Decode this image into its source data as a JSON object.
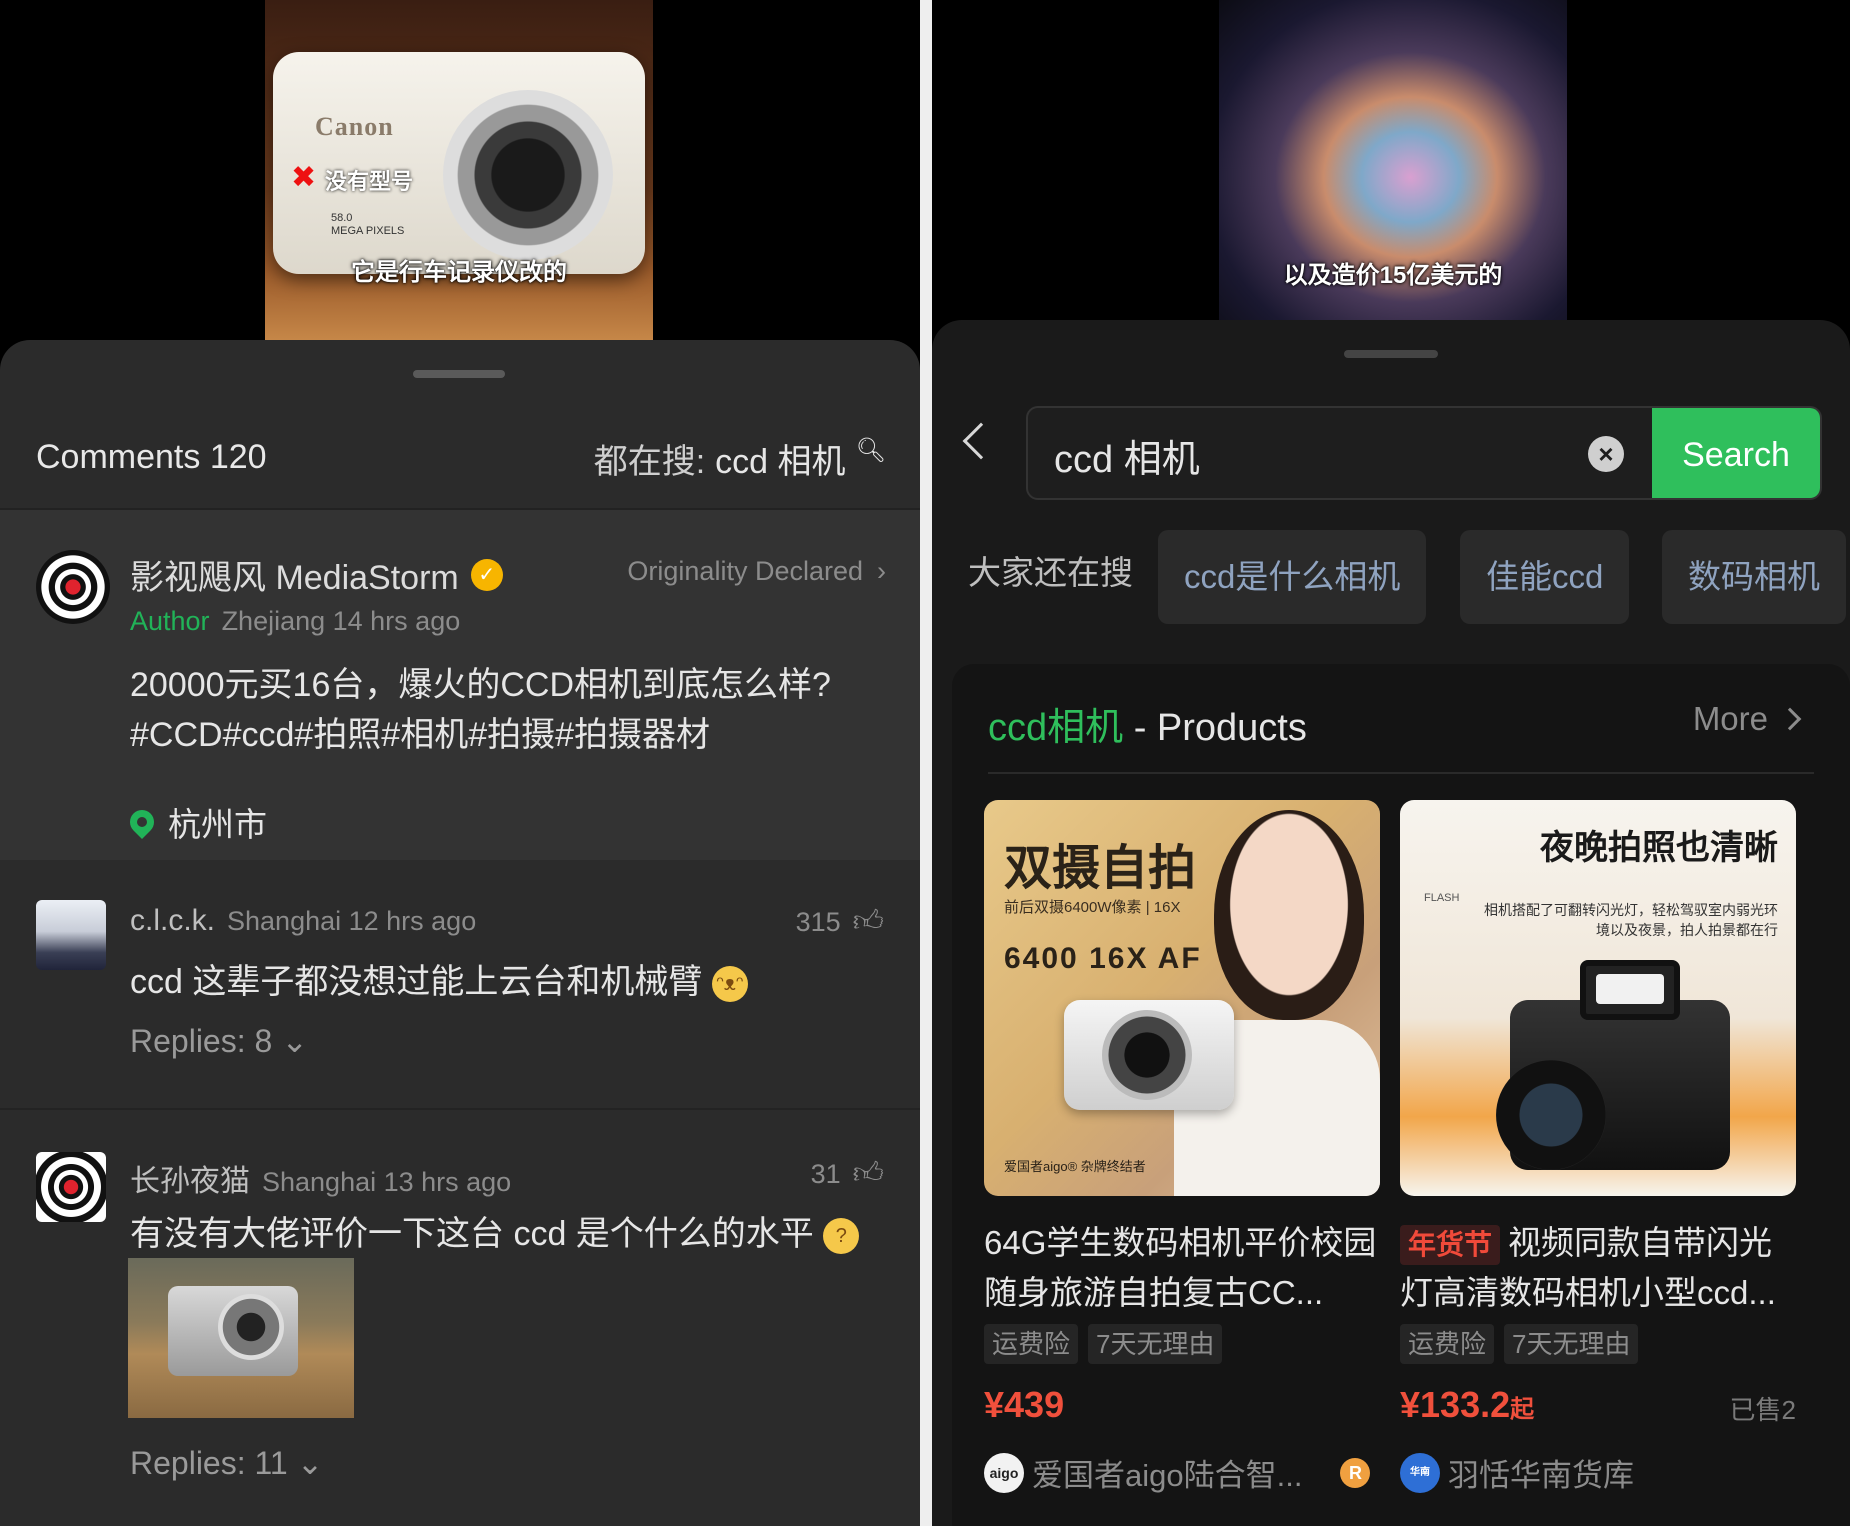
{
  "left": {
    "video": {
      "caption": "它是行车记录仪改的",
      "brand": "Canon",
      "mark": "✖",
      "note": "没有型号",
      "mp_line1": "58.0",
      "mp_line2": "MEGA PIXELS"
    },
    "header": {
      "title": "Comments 120",
      "search_prefix": "都在搜:",
      "search_keyword": "ccd 相机"
    },
    "author_post": {
      "name": "影视飓风 MediaStorm",
      "originality": "Originality Declared",
      "role": "Author",
      "meta": "Zhejiang 14 hrs ago",
      "text": "20000元买16台，爆火的CCD相机到底怎么样?#CCD#ccd#拍照#相机#拍摄#拍摄器材",
      "location": "杭州市"
    },
    "comments": [
      {
        "user": "c.l.c.k.",
        "meta": "Shanghai 12 hrs ago",
        "likes": "315",
        "text": "ccd 这辈子都没想过能上云台和机械臂",
        "replies": "Replies: 8"
      },
      {
        "user": "长孙夜猫",
        "meta": "Shanghai 13 hrs ago",
        "likes": "31",
        "text": "有没有大佬评价一下这台 ccd 是个什么的水平",
        "replies": "Replies: 11"
      }
    ]
  },
  "right": {
    "video": {
      "caption": "以及造价15亿美元的"
    },
    "search": {
      "query": "ccd 相机",
      "button": "Search"
    },
    "suggest": {
      "label": "大家还在搜",
      "chips": [
        "ccd是什么相机",
        "佳能ccd",
        "数码相机"
      ]
    },
    "products_section": {
      "keyword": "ccd相机",
      "suffix": " - Products",
      "more": "More"
    },
    "products": [
      {
        "img_title": "双摄自拍",
        "img_sub": "前后双摄6400W像素  |  16X",
        "img_spec": "6400 16X AF",
        "img_foot": "爱国者aigo® 杂牌终结者",
        "tag": "",
        "name": "64G学生数码相机平价校园随身旅游自拍复古CC...",
        "badges": [
          "运费险",
          "7天无理由"
        ],
        "price": "¥439",
        "price_suffix": "",
        "sold": "",
        "shop_logo": "aigo",
        "shop": "爱国者aigo陆合智..."
      },
      {
        "img_title": "夜晚拍照也清晰",
        "img_sub": "相机搭配了可翻转闪光灯，轻松驾驭室内弱光环境以及夜景，拍人拍景都在行",
        "img_flash": "FLASH",
        "tag": "年货节",
        "name": "视频同款自带闪光灯高清数码相机小型ccd...",
        "badges": [
          "运费险",
          "7天无理由"
        ],
        "price": "¥133.2",
        "price_suffix": "起",
        "sold": "已售2",
        "shop_logo": "羽恬华南货库",
        "shop": "羽恬华南货库"
      }
    ]
  }
}
